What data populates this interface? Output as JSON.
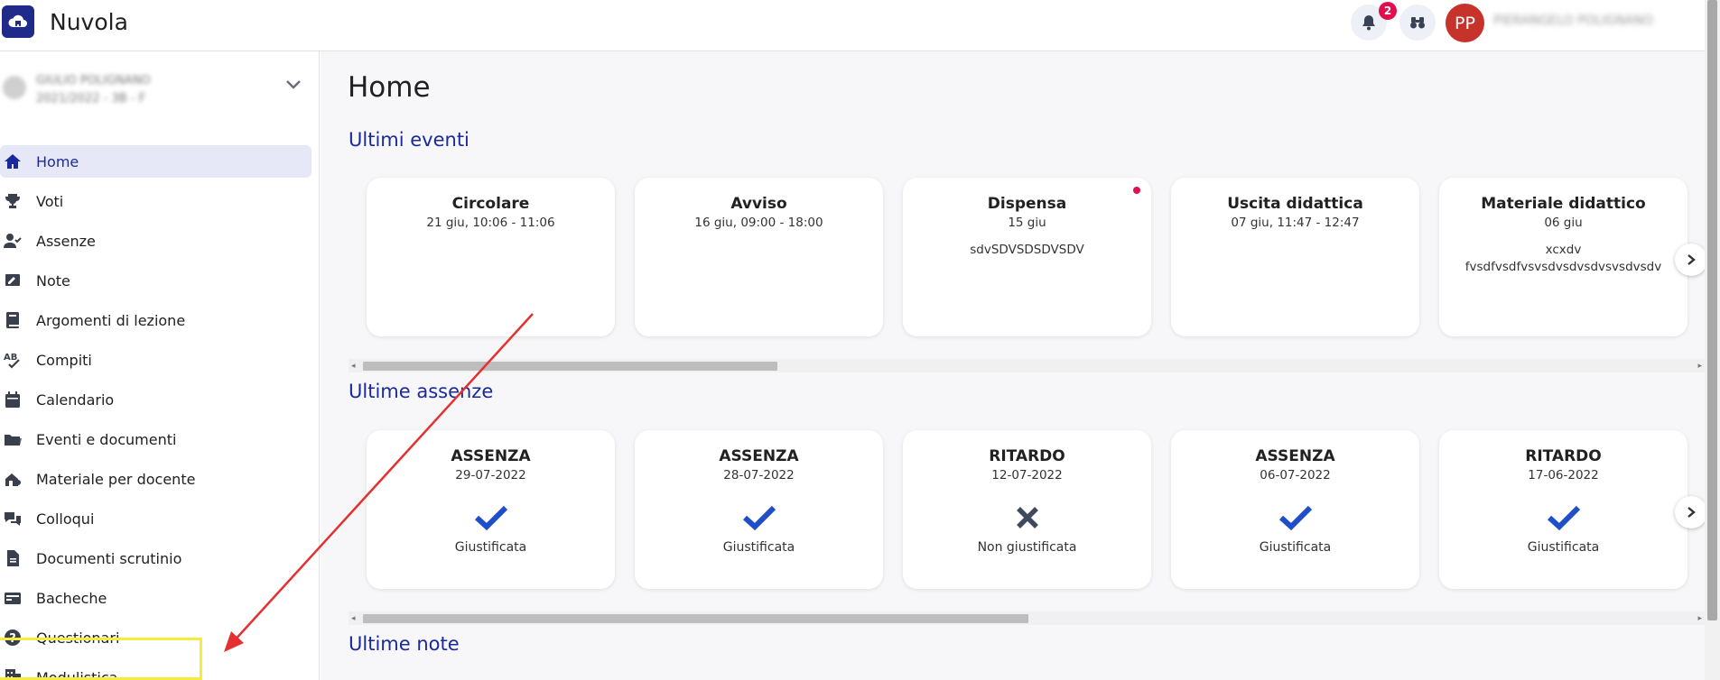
{
  "app": {
    "title": "Nuvola",
    "notifications_count": "2",
    "avatar_initials": "PP",
    "user_name": "PIERANGELO POLIGNANO"
  },
  "student": {
    "name": "GIULIO POLIGNANO",
    "class": "2021/2022 - 3B - F"
  },
  "sidebar": {
    "items": [
      {
        "label": "Home",
        "icon": "home-icon",
        "active": true
      },
      {
        "label": "Voti",
        "icon": "trophy-icon"
      },
      {
        "label": "Assenze",
        "icon": "user-check-icon"
      },
      {
        "label": "Note",
        "icon": "note-icon"
      },
      {
        "label": "Argomenti di lezione",
        "icon": "book-icon"
      },
      {
        "label": "Compiti",
        "icon": "spellcheck-icon"
      },
      {
        "label": "Calendario",
        "icon": "calendar-icon"
      },
      {
        "label": "Eventi e documenti",
        "icon": "folder-icon"
      },
      {
        "label": "Materiale per docente",
        "icon": "teacher-material-icon"
      },
      {
        "label": "Colloqui",
        "icon": "chat-icon"
      },
      {
        "label": "Documenti scrutinio",
        "icon": "document-icon"
      },
      {
        "label": "Bacheche",
        "icon": "board-icon"
      },
      {
        "label": "Questionari",
        "icon": "question-icon"
      },
      {
        "label": "Modulistica",
        "icon": "forms-icon"
      }
    ]
  },
  "main": {
    "page_title": "Home",
    "events_title": "Ultimi eventi",
    "absences_title": "Ultime assenze",
    "notes_title": "Ultime note"
  },
  "events": [
    {
      "title": "Circolare",
      "date": "21 giu, 10:06 - 11:06",
      "desc": [],
      "unread": false
    },
    {
      "title": "Avviso",
      "date": "16 giu, 09:00 - 18:00",
      "desc": [],
      "unread": false
    },
    {
      "title": "Dispensa",
      "date": "15 giu",
      "desc": [
        "sdvSDVSDSDVSDV"
      ],
      "unread": true
    },
    {
      "title": "Uscita didattica",
      "date": "07 giu, 11:47 - 12:47",
      "desc": [],
      "unread": false
    },
    {
      "title": "Materiale didattico",
      "date": "06 giu",
      "desc": [
        "xcxdv",
        "fvsdfvsdfvsvsdvsdvsdvsvsdvsdv"
      ],
      "unread": false
    }
  ],
  "absences": [
    {
      "type": "ASSENZA",
      "date": "29-07-2022",
      "status": "Giustificata",
      "justified": true
    },
    {
      "type": "ASSENZA",
      "date": "28-07-2022",
      "status": "Giustificata",
      "justified": true
    },
    {
      "type": "RITARDO",
      "date": "12-07-2022",
      "status": "Non giustificata",
      "justified": false
    },
    {
      "type": "ASSENZA",
      "date": "06-07-2022",
      "status": "Giustificata",
      "justified": true
    },
    {
      "type": "RITARDO",
      "date": "17-06-2022",
      "status": "Giustificata",
      "justified": true
    }
  ],
  "colors": {
    "accent": "#1a2a9a",
    "check": "#1f4fc8",
    "cross": "#3f4a5e",
    "badge": "#e0104e",
    "avatar": "#c7322a",
    "annotation_arrow": "#e53030",
    "annotation_box": "#f6ec3a"
  }
}
